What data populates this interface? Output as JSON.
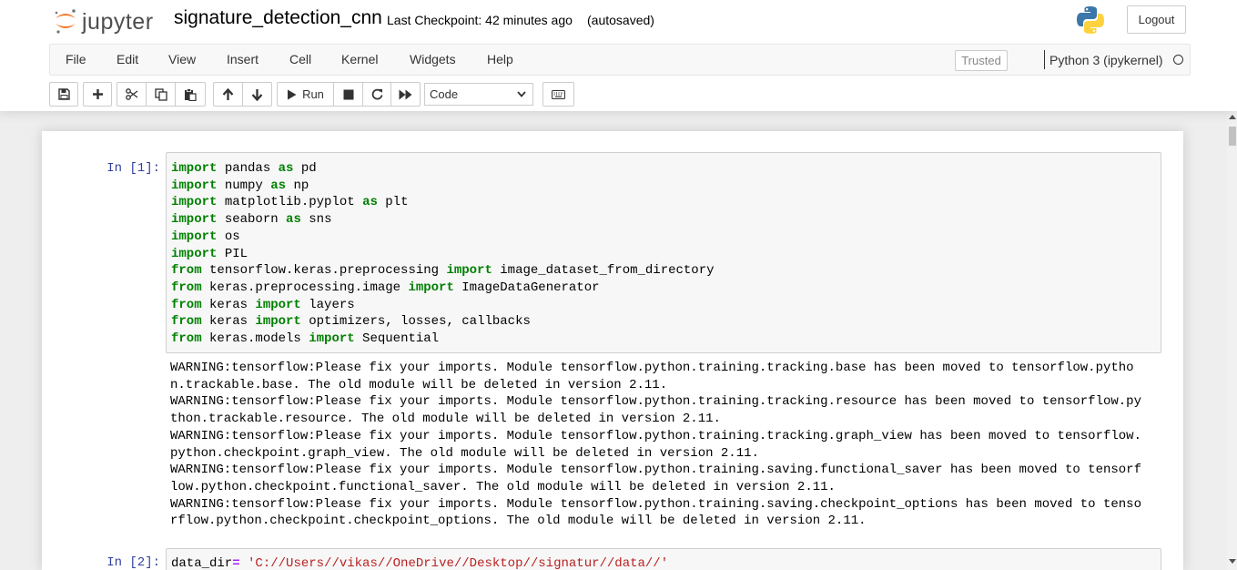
{
  "header": {
    "logo_text": "jupyter",
    "notebook_name": "signature_detection_cnn",
    "checkpoint": "Last Checkpoint: 42 minutes ago",
    "autosave": "(autosaved)",
    "logout": "Logout"
  },
  "menubar": {
    "items": [
      "File",
      "Edit",
      "View",
      "Insert",
      "Cell",
      "Kernel",
      "Widgets",
      "Help"
    ],
    "trusted": "Trusted",
    "kernel": "Python 3 (ipykernel)"
  },
  "toolbar": {
    "run_label": "Run",
    "cell_type": "Code"
  },
  "cells": [
    {
      "prompt": "In [1]:",
      "code": [
        [
          [
            "kw",
            "import"
          ],
          [
            "t",
            " pandas "
          ],
          [
            "kw",
            "as"
          ],
          [
            "t",
            " pd"
          ]
        ],
        [
          [
            "kw",
            "import"
          ],
          [
            "t",
            " numpy "
          ],
          [
            "kw",
            "as"
          ],
          [
            "t",
            " np"
          ]
        ],
        [
          [
            "kw",
            "import"
          ],
          [
            "t",
            " matplotlib.pyplot "
          ],
          [
            "kw",
            "as"
          ],
          [
            "t",
            " plt"
          ]
        ],
        [
          [
            "kw",
            "import"
          ],
          [
            "t",
            " seaborn "
          ],
          [
            "kw",
            "as"
          ],
          [
            "t",
            " sns"
          ]
        ],
        [
          [
            "kw",
            "import"
          ],
          [
            "t",
            " os"
          ]
        ],
        [
          [
            "kw",
            "import"
          ],
          [
            "t",
            " PIL"
          ]
        ],
        [
          [
            "kw",
            "from"
          ],
          [
            "t",
            " tensorflow.keras.preprocessing "
          ],
          [
            "kw",
            "import"
          ],
          [
            "t",
            " image_dataset_from_directory"
          ]
        ],
        [
          [
            "kw",
            "from"
          ],
          [
            "t",
            " keras.preprocessing.image "
          ],
          [
            "kw",
            "import"
          ],
          [
            "t",
            " ImageDataGenerator"
          ]
        ],
        [
          [
            "kw",
            "from"
          ],
          [
            "t",
            " keras "
          ],
          [
            "kw",
            "import"
          ],
          [
            "t",
            " layers"
          ]
        ],
        [
          [
            "kw",
            "from"
          ],
          [
            "t",
            " keras "
          ],
          [
            "kw",
            "import"
          ],
          [
            "t",
            " optimizers, losses, callbacks"
          ]
        ],
        [
          [
            "kw",
            "from"
          ],
          [
            "t",
            " keras.models "
          ],
          [
            "kw",
            "import"
          ],
          [
            "t",
            " Sequential"
          ]
        ]
      ],
      "output": [
        "WARNING:tensorflow:Please fix your imports. Module tensorflow.python.training.tracking.base has been moved to tensorflow.pytho",
        "n.trackable.base. The old module will be deleted in version 2.11.",
        "WARNING:tensorflow:Please fix your imports. Module tensorflow.python.training.tracking.resource has been moved to tensorflow.py",
        "thon.trackable.resource. The old module will be deleted in version 2.11.",
        "WARNING:tensorflow:Please fix your imports. Module tensorflow.python.training.tracking.graph_view has been moved to tensorflow.",
        "python.checkpoint.graph_view. The old module will be deleted in version 2.11.",
        "WARNING:tensorflow:Please fix your imports. Module tensorflow.python.training.saving.functional_saver has been moved to tensorf",
        "low.python.checkpoint.functional_saver. The old module will be deleted in version 2.11.",
        "WARNING:tensorflow:Please fix your imports. Module tensorflow.python.training.saving.checkpoint_options has been moved to tenso",
        "rflow.python.checkpoint.checkpoint_options. The old module will be deleted in version 2.11."
      ]
    },
    {
      "prompt": "In [2]:",
      "code": [
        [
          [
            "t",
            "data_dir"
          ],
          [
            "op",
            "="
          ],
          [
            "t",
            " "
          ],
          [
            "str",
            "'C://Users//vikas//OneDrive//Desktop//signatur//data//'"
          ]
        ]
      ]
    }
  ]
}
